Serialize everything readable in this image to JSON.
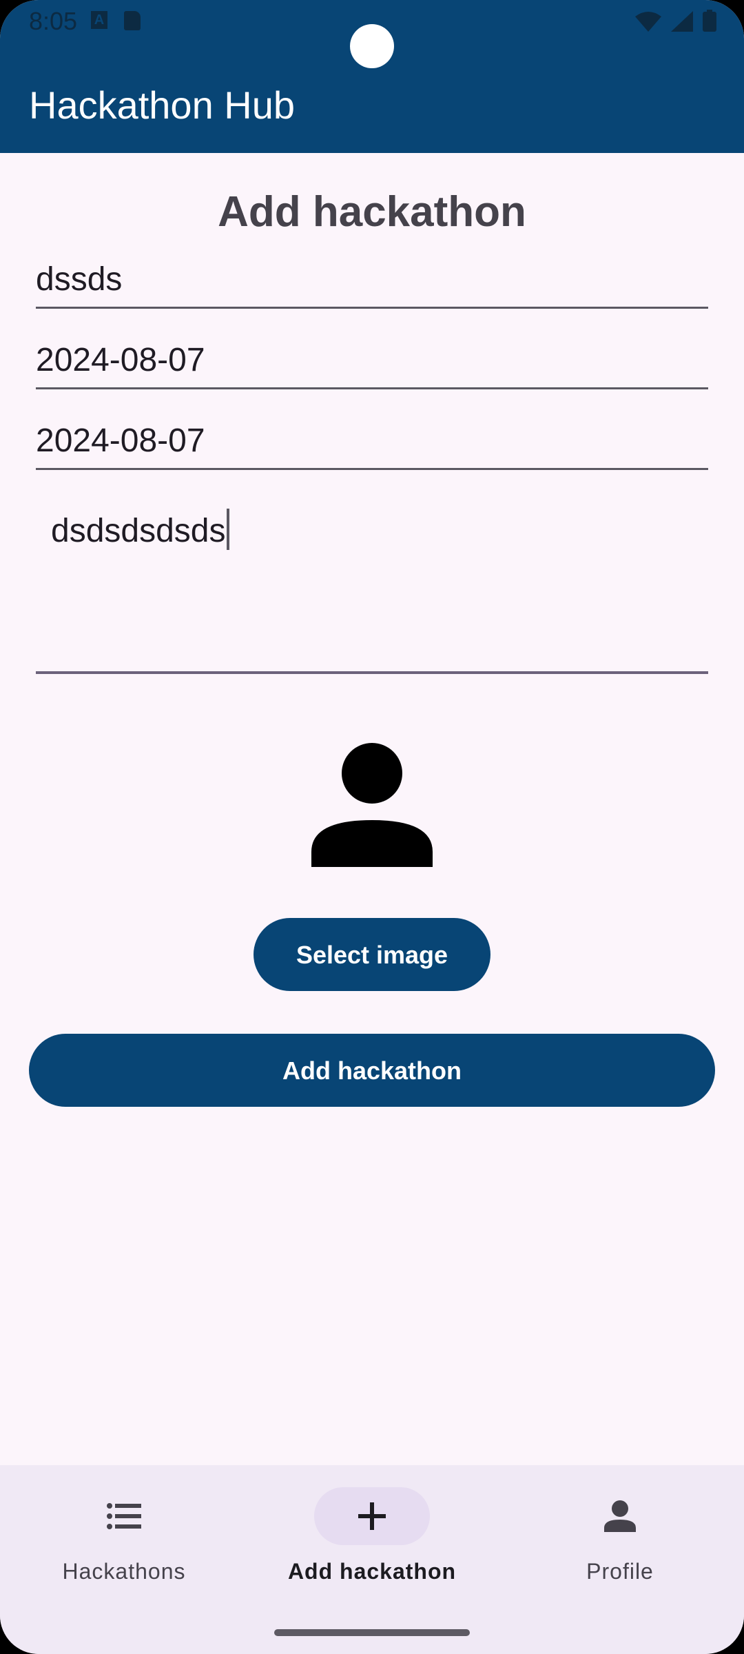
{
  "status_bar": {
    "time": "8:05",
    "notification_icon_letter": "A",
    "icons_left": [
      "app-a-icon",
      "sd-card-icon"
    ],
    "icons_right": [
      "wifi-icon",
      "signal-icon",
      "battery-icon"
    ]
  },
  "app_bar": {
    "title": "Hackathon Hub"
  },
  "form": {
    "heading": "Add hackathon",
    "name_value": "dssds",
    "start_date_value": "2024-08-07",
    "end_date_value": "2024-08-07",
    "description_value": "dsdsdsdsds",
    "image_placeholder_icon": "person-icon",
    "select_image_label": "Select image",
    "submit_label": "Add hackathon"
  },
  "bottom_nav": {
    "items": [
      {
        "label": "Hackathons",
        "icon": "list-icon",
        "active": false
      },
      {
        "label": "Add hackathon",
        "icon": "plus-icon",
        "active": true
      },
      {
        "label": "Profile",
        "icon": "person-icon",
        "active": false
      }
    ]
  },
  "colors": {
    "primary": "#084575",
    "background": "#fcf5fb",
    "nav_background": "#f0e9f5",
    "active_indicator": "#e6dcf1"
  }
}
